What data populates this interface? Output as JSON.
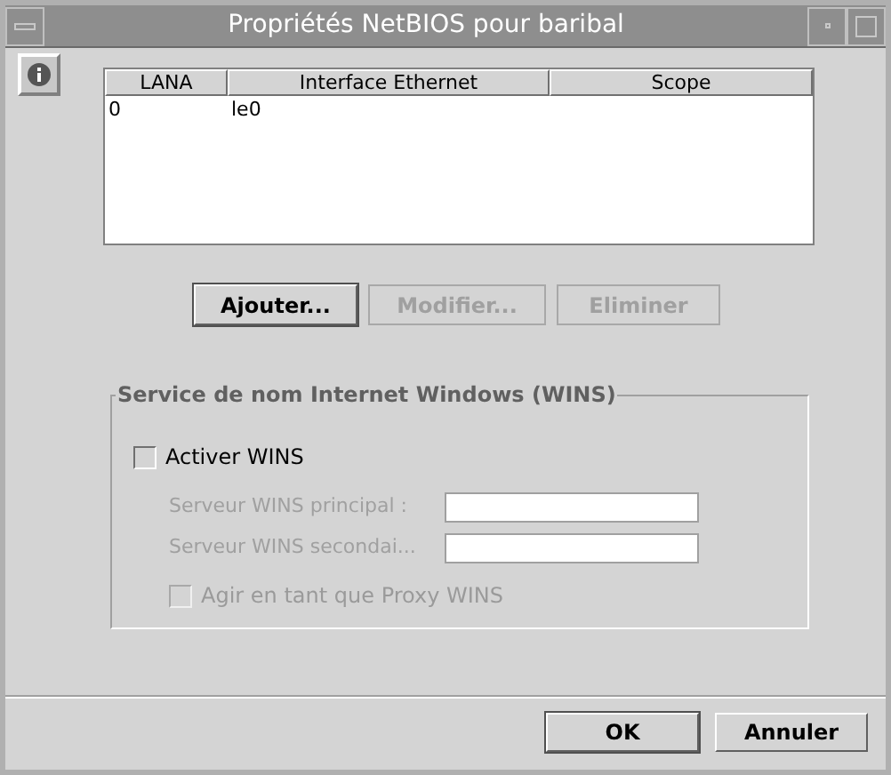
{
  "window": {
    "title": "Propriétés NetBIOS pour baribal"
  },
  "table": {
    "columns": [
      "LANA",
      "Interface Ethernet",
      "Scope"
    ],
    "rows": [
      [
        "0",
        "le0",
        ""
      ]
    ]
  },
  "actions": [
    {
      "label": "Ajouter...",
      "disabled": false
    },
    {
      "label": "Modifier...",
      "disabled": true
    },
    {
      "label": "Eliminer",
      "disabled": true
    }
  ],
  "wins": {
    "legend": "Service de nom Internet Windows (WINS)",
    "enable": {
      "label": "Activer WINS",
      "checked": false,
      "disabled": false
    },
    "fields": [
      {
        "label": "Serveur WINS principal :",
        "disabled": true
      },
      {
        "label": "Serveur WINS secondai...",
        "disabled": true
      }
    ],
    "proxy": {
      "label": "Agir en tant que Proxy WINS",
      "checked": false,
      "disabled": true
    }
  },
  "buttons": [
    {
      "label": "OK",
      "default": true
    },
    {
      "label": "Annuler",
      "default": false
    }
  ]
}
